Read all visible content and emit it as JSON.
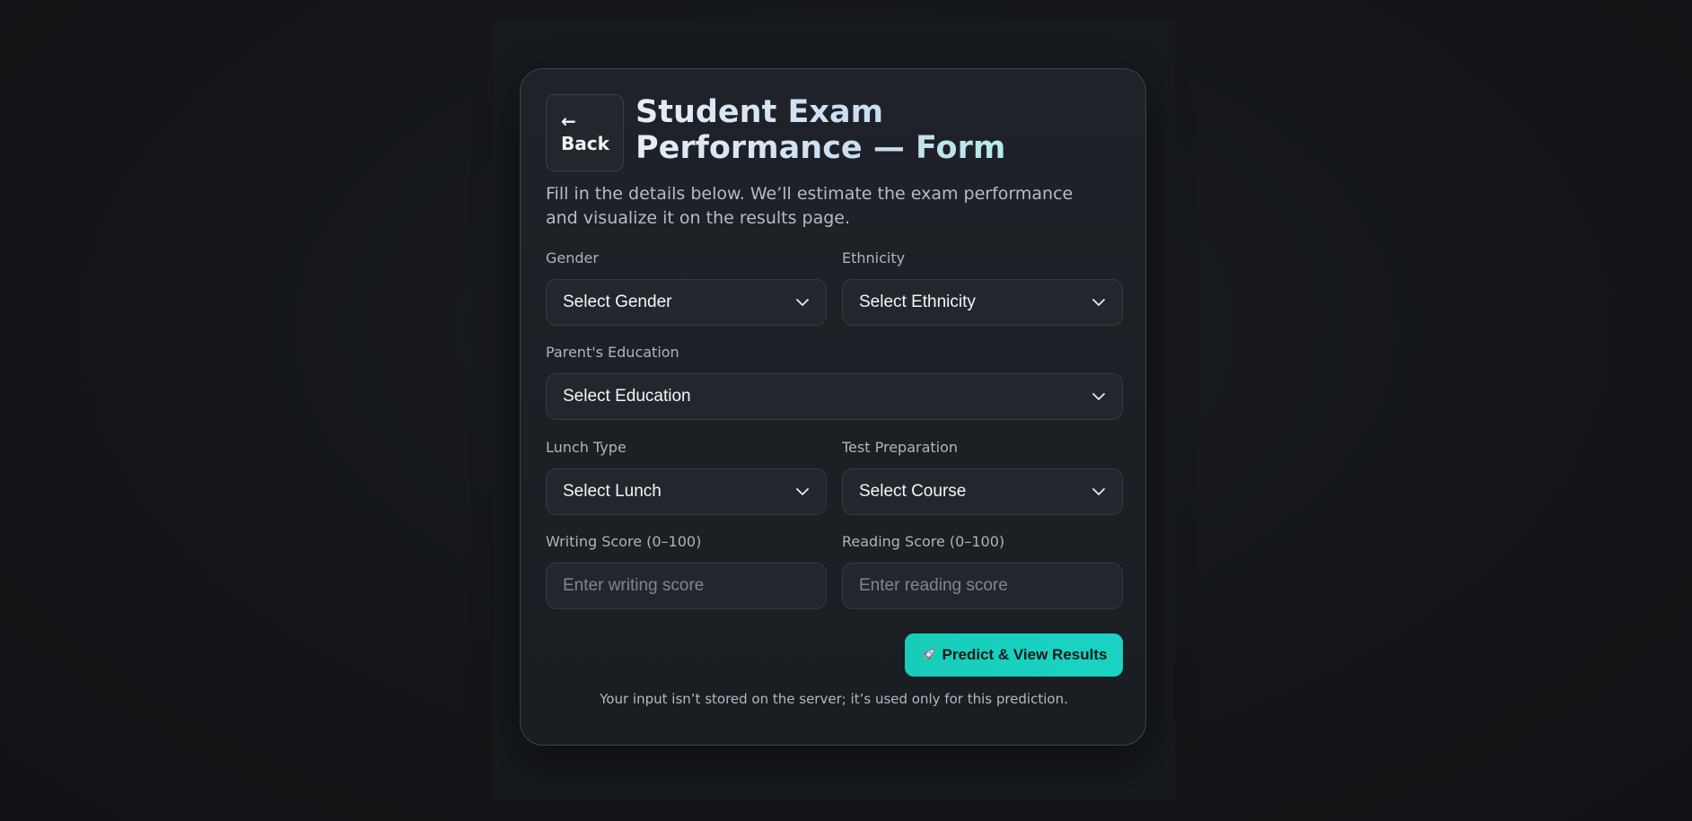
{
  "back_button": {
    "arrow": "←",
    "label": "Back"
  },
  "header": {
    "title": "Student Exam Performance — Form",
    "subtitle": "Fill in the details below. We’ll estimate the exam performance and visualize it on the results page."
  },
  "form": {
    "gender": {
      "label": "Gender",
      "value": "Select Gender"
    },
    "ethnicity": {
      "label": "Ethnicity",
      "value": "Select Ethnicity"
    },
    "parent_education": {
      "label": "Parent's Education",
      "value": "Select Education"
    },
    "lunch": {
      "label": "Lunch Type",
      "value": "Select Lunch"
    },
    "test_prep": {
      "label": "Test Preparation",
      "value": "Select Course"
    },
    "writing_score": {
      "label": "Writing Score (0–100)",
      "placeholder": "Enter writing score"
    },
    "reading_score": {
      "label": "Reading Score (0–100)",
      "placeholder": "Enter reading score"
    },
    "submit_label": "Predict & View Results",
    "submit_icon": "rocket-icon",
    "footnote": "Your input isn’t stored on the server; it’s used only for this prediction."
  },
  "colors": {
    "accent": "#17cdb9",
    "background": "#121417",
    "card": "#1f2329",
    "border": "#2c4a4c"
  }
}
